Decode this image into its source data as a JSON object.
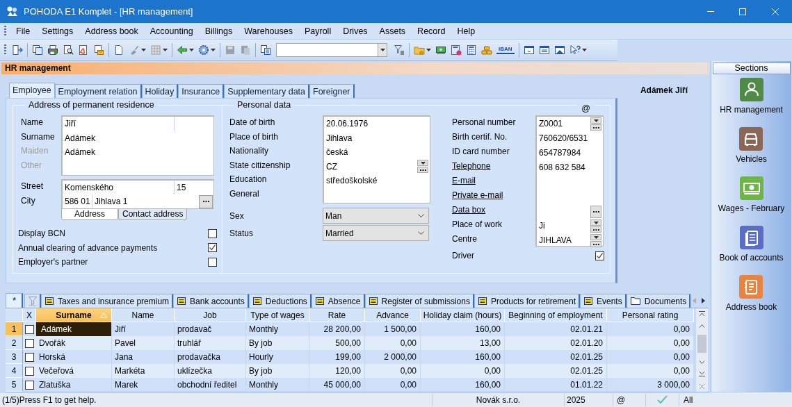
{
  "window": {
    "title": "POHODA E1 Komplet - [HR management]"
  },
  "menu": [
    "File",
    "Settings",
    "Address book",
    "Accounting",
    "Billings",
    "Warehouses",
    "Payroll",
    "Drives",
    "Assets",
    "Record",
    "Help"
  ],
  "toolbar": {
    "iban": "IBAN"
  },
  "agenda": {
    "title": "HR management",
    "record_title": "Adámek Jiří",
    "tabs": [
      {
        "label": "Employee",
        "selected": true
      },
      {
        "label": "Employment relation",
        "selected": false
      },
      {
        "label": "Holiday",
        "selected": false
      },
      {
        "label": "Insurance",
        "selected": false
      },
      {
        "label": "Supplementary data",
        "selected": false
      },
      {
        "label": "Foreigner",
        "selected": false
      }
    ]
  },
  "address": {
    "title": "Address of permanent residence",
    "name_fields": [
      {
        "label": "Name",
        "value": "Jiří",
        "disabled": false
      },
      {
        "label": "Surname",
        "value": "Adámek",
        "disabled": false
      },
      {
        "label": "Maiden",
        "value": "Adámek",
        "disabled": true
      },
      {
        "label": "Other",
        "disabled": true
      }
    ],
    "street": {
      "label": "Street",
      "value": "Komenského",
      "number": "15"
    },
    "city": {
      "label": "City",
      "zip": "586 01",
      "value": "Jihlava 1"
    },
    "tabs": [
      {
        "label": "Address",
        "selected": true
      },
      {
        "label": "Contact address",
        "selected": false
      }
    ]
  },
  "options": [
    {
      "label": "Display BCN",
      "checked": false
    },
    {
      "label": "Annual clearing of advance payments",
      "checked": true
    },
    {
      "label": "Employer's partner",
      "checked": false
    }
  ],
  "personal": {
    "title": "Personal data",
    "at_sign": "@",
    "fields": [
      {
        "label": "Date of birth",
        "value": "20.06.1976",
        "kind": "plain"
      },
      {
        "label": "Place of birth",
        "value": "Jihlava",
        "kind": "plain"
      },
      {
        "label": "Nationality",
        "value": "česká",
        "kind": "plain"
      },
      {
        "label": "State citizenship",
        "value": "CZ",
        "kind": "combo"
      },
      {
        "label": "Education",
        "value": "středoškolské",
        "kind": "plain"
      },
      {
        "label": "General",
        "kind": "plain"
      }
    ],
    "selects": [
      {
        "label": "Sex",
        "value": "Man"
      },
      {
        "label": "Status",
        "value": "Married"
      }
    ],
    "ids": [
      {
        "label": "Personal number",
        "value": "Z0001",
        "kind": "combo",
        "link": false
      },
      {
        "label": "Birth certif. No.",
        "value": "760620/6531",
        "kind": "plain",
        "link": false
      },
      {
        "label": "ID card number",
        "value": "654787984",
        "kind": "plain",
        "link": false
      },
      {
        "label": "Telephone",
        "value": "608 632 584",
        "kind": "plain",
        "link": true
      },
      {
        "label": "E-mail",
        "kind": "plain",
        "link": true
      },
      {
        "label": "Private e-mail",
        "kind": "plain",
        "link": true
      },
      {
        "label": "Data box",
        "kind": "browse",
        "link": true
      },
      {
        "label": "Place of work",
        "value": "Ji",
        "kind": "combo",
        "link": false
      },
      {
        "label": "Centre",
        "value": "JIHLAVA",
        "kind": "combo",
        "link": false
      }
    ],
    "driver": {
      "label": "Driver",
      "checked": true
    }
  },
  "bottom_tabs": {
    "tabs": [
      {
        "label": "*",
        "kind": "star",
        "selected": true
      },
      {
        "kind": "filter",
        "selected": false
      },
      {
        "label": "Taxes and insurance premium",
        "kind": "list",
        "selected": false
      },
      {
        "label": "Bank accounts",
        "kind": "list",
        "selected": false
      },
      {
        "label": "Deductions",
        "kind": "list",
        "selected": false
      },
      {
        "label": "Absence",
        "kind": "list",
        "selected": false
      },
      {
        "label": "Register of submissions",
        "kind": "list",
        "selected": false
      },
      {
        "label": "Products for retirement",
        "kind": "list",
        "selected": false
      },
      {
        "label": "Events",
        "kind": "list",
        "selected": false
      },
      {
        "label": "Documents",
        "kind": "folder",
        "selected": false
      }
    ]
  },
  "table": {
    "columns": [
      {
        "label": "X",
        "sorted": false
      },
      {
        "label": "Surname",
        "sorted": true
      },
      {
        "label": "Name",
        "sorted": false
      },
      {
        "label": "Job",
        "sorted": false
      },
      {
        "label": "Type of wages",
        "sorted": false
      },
      {
        "label": "Rate",
        "sorted": false
      },
      {
        "label": "Advance",
        "sorted": false
      },
      {
        "label": "Holiday claim (hours)",
        "sorted": false
      },
      {
        "label": "Beginning of employment",
        "sorted": false
      },
      {
        "label": "Personal rating",
        "sorted": false
      }
    ],
    "rows": [
      {
        "number": "1",
        "selected": true,
        "checked": false,
        "cells": [
          "",
          "Adámek",
          "Jiří",
          "prodavač",
          "Monthly",
          "28 200,00",
          "1 500,00",
          "160,00",
          "02.01.21",
          "0,00"
        ]
      },
      {
        "number": "2",
        "selected": false,
        "checked": false,
        "cells": [
          "",
          "Dvořák",
          "Pavel",
          "truhlář",
          "By job",
          "500,00",
          "0,00",
          "13,00",
          "02.01.20",
          "0,00"
        ]
      },
      {
        "number": "3",
        "selected": false,
        "checked": false,
        "cells": [
          "",
          "Horská",
          "Jana",
          "prodavačka",
          "Hourly",
          "199,00",
          "2 000,00",
          "160,00",
          "02.01.25",
          "0,00"
        ]
      },
      {
        "number": "4",
        "selected": false,
        "checked": false,
        "cells": [
          "",
          "Večeřová",
          "Markéta",
          "uklízečka",
          "By job",
          "120,00",
          "0,00",
          "0,00",
          "02.01.25",
          "0,00"
        ]
      },
      {
        "number": "5",
        "selected": false,
        "checked": false,
        "cells": [
          "",
          "Zlatuška",
          "Marek",
          "obchodní ředitel",
          "Monthly",
          "45 000,00",
          "0,00",
          "160,00",
          "01.01.22",
          "3 000,00"
        ]
      }
    ]
  },
  "sidebar": {
    "title": "Sections",
    "items": [
      {
        "label": "HR management",
        "color": "#4f8a47"
      },
      {
        "label": "Vehicles",
        "color": "#8a6656"
      },
      {
        "label": "Wages - February",
        "color": "#6db646"
      },
      {
        "label": "Book of accounts",
        "color": "#5b6ec5"
      },
      {
        "label": "Address book",
        "color": "#e8843f"
      }
    ]
  },
  "status_bar": {
    "help": "(1/5)Press F1 to get help.",
    "company": "Novák s.r.o.",
    "year": "2025",
    "at_sign": "@",
    "mode": "All"
  }
}
